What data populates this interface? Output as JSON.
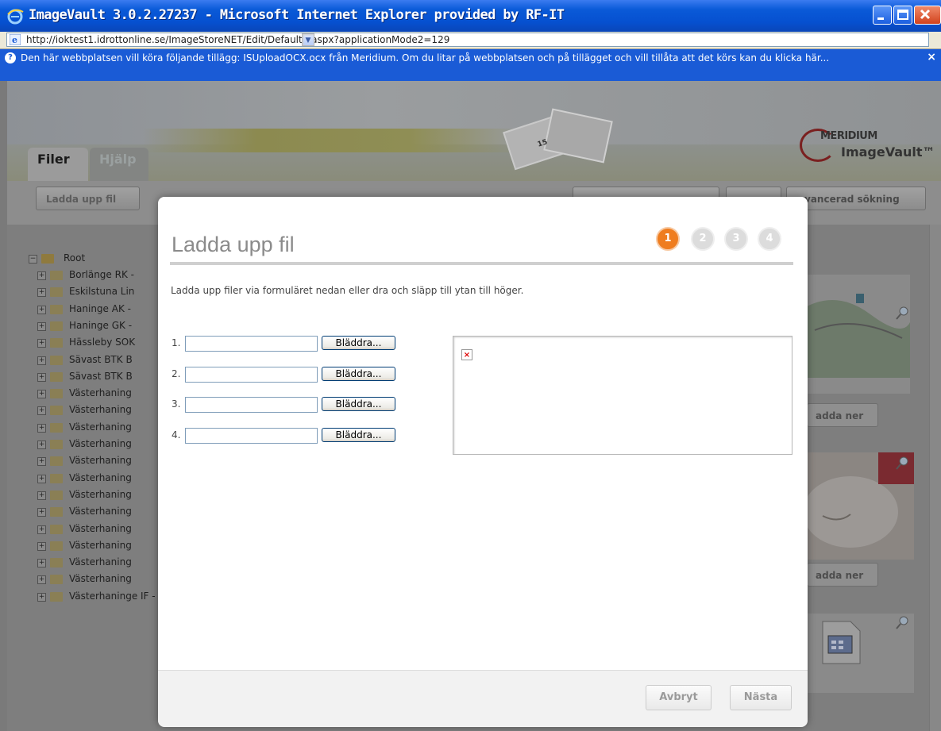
{
  "window": {
    "title": "ImageVault 3.0.2.27237 - Microsoft Internet Explorer provided by RF-IT",
    "url": "http://ioktest1.idrottonline.se/ImageStoreNET/Edit/Default2.aspx?applicationMode2=129",
    "infobar": "Den här webbplatsen vill köra följande tillägg: ISUploadOCX.ocx från Meridium. Om du litar på webbplatsen och på tillägget och vill tillåta att det körs kan du klicka här..."
  },
  "app": {
    "tabs": [
      {
        "label": "Filer"
      },
      {
        "label": "Hjälp"
      }
    ],
    "toolbar": {
      "upload_label": "Ladda upp fil",
      "advanced_search_label": "vancerad sökning"
    },
    "logo": {
      "brand": "MERIDIUM",
      "product": "ImageVault™"
    },
    "header_photo_text": "15",
    "tree": {
      "root": "Root",
      "items": [
        "Borlänge RK -",
        "Eskilstuna Lin",
        "Haninge AK -",
        "Haninge GK -",
        "Hässleby SOK",
        "Sävast BTK B",
        "Sävast BTK B",
        "Västerhaning",
        "Västerhaning",
        "Västerhaning",
        "Västerhaning",
        "Västerhaning",
        "Västerhaning",
        "Västerhaning",
        "Västerhaning",
        "Västerhaning",
        "Västerhaning",
        "Västerhaning",
        "Västerhaning",
        "Västerhaninge IF - Tcher"
      ]
    },
    "cards": {
      "download_label": "adda ner"
    }
  },
  "modal": {
    "title": "Ladda upp fil",
    "steps": [
      "1",
      "2",
      "3",
      "4"
    ],
    "active_step": 1,
    "description": "Ladda upp filer via formuläret nedan eller dra och släpp till ytan till höger.",
    "upload_rows": [
      {
        "number": "1.",
        "value": "",
        "browse_label": "Bläddra..."
      },
      {
        "number": "2.",
        "value": "",
        "browse_label": "Bläddra..."
      },
      {
        "number": "3.",
        "value": "",
        "browse_label": "Bläddra..."
      },
      {
        "number": "4.",
        "value": "",
        "browse_label": "Bläddra..."
      }
    ],
    "broken_image_glyph": "×",
    "buttons": {
      "cancel": "Avbryt",
      "next": "Nästa"
    }
  },
  "colors": {
    "step_active": "#ef7d1f",
    "step_inactive": "#dcdcdc",
    "titlebar": "#0650d0"
  }
}
